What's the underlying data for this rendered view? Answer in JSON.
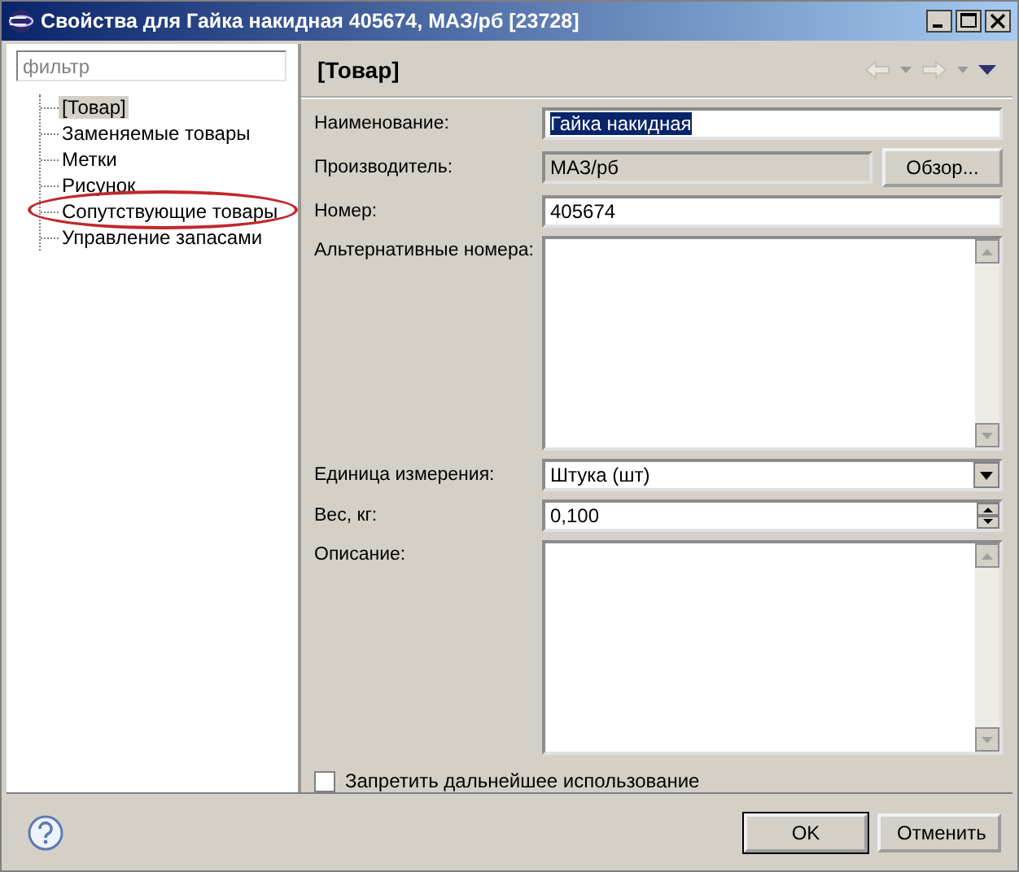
{
  "window": {
    "title": "Свойства для Гайка накидная 405674, МАЗ/рб [23728]"
  },
  "sidebar": {
    "filter": {
      "placeholder": "фильтр"
    },
    "items": [
      {
        "label": "[Товар]",
        "selected": true,
        "highlighted": false
      },
      {
        "label": "Заменяемые товары",
        "selected": false,
        "highlighted": false
      },
      {
        "label": "Метки",
        "selected": false,
        "highlighted": false
      },
      {
        "label": "Рисунок",
        "selected": false,
        "highlighted": false
      },
      {
        "label": "Сопутствующие товары",
        "selected": false,
        "highlighted": true
      },
      {
        "label": "Управление запасами",
        "selected": false,
        "highlighted": false
      }
    ]
  },
  "page": {
    "title": "[Товар]",
    "fields": [
      {
        "kind": "text",
        "label": "Наименование:",
        "value": "Гайка накидная",
        "text_selected": true,
        "disabled": false
      },
      {
        "kind": "browse",
        "label": "Производитель:",
        "value": "МАЗ/рб",
        "disabled": true,
        "button": "Обзор..."
      },
      {
        "kind": "text",
        "label": "Номер:",
        "value": "405674",
        "text_selected": false,
        "disabled": false
      },
      {
        "kind": "textarea",
        "label": "Альтернативные номера:"
      },
      {
        "kind": "dropdown",
        "label": "Единица измерения:",
        "value": "Штука (шт)"
      },
      {
        "kind": "spinner",
        "label": "Вес, кг:",
        "value": "0,100"
      },
      {
        "kind": "textarea",
        "label": "Описание:"
      }
    ],
    "checkbox": {
      "label": "Запретить дальнейшее использование",
      "checked": false
    }
  },
  "buttons": [
    {
      "label": "OK",
      "default": true
    },
    {
      "label": "Отменить",
      "default": false
    }
  ]
}
